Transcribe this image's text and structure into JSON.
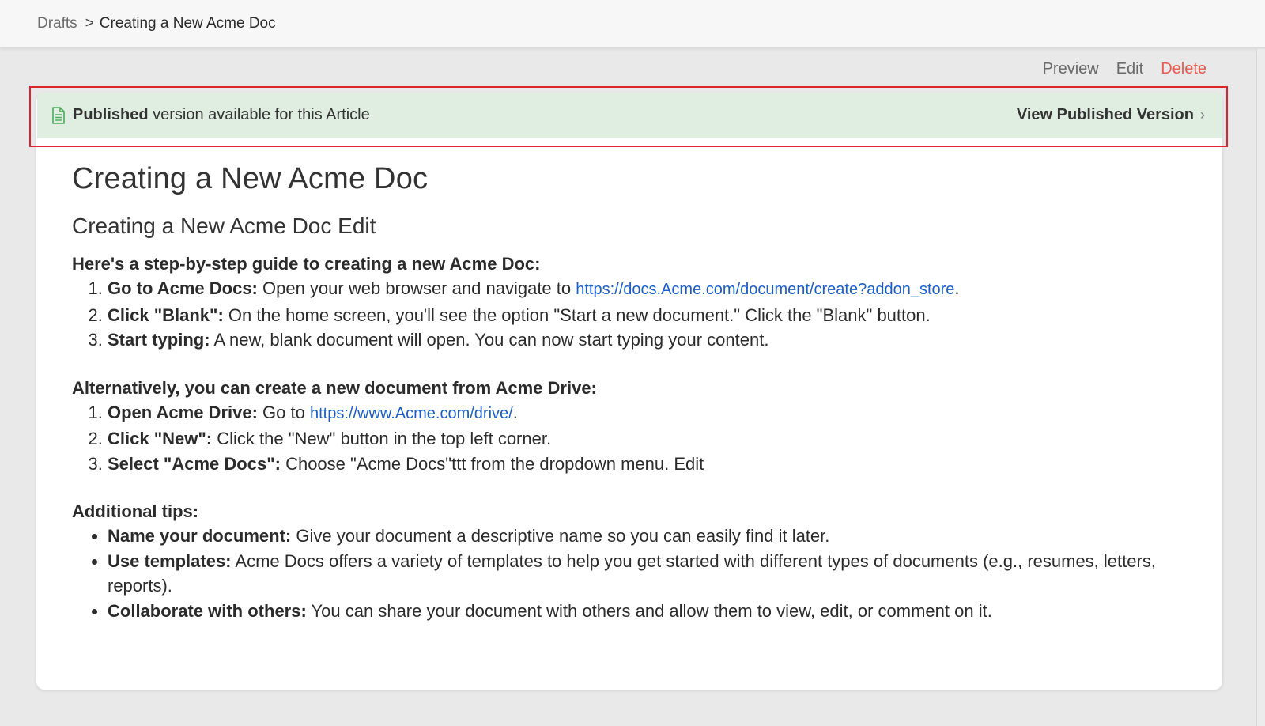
{
  "breadcrumb": {
    "parent": "Drafts",
    "separator": ">",
    "current": "Creating a New Acme Doc"
  },
  "actions": {
    "preview": "Preview",
    "edit": "Edit",
    "delete": "Delete"
  },
  "banner": {
    "icon": "document-icon",
    "bold_text": "Published",
    "text": "version available for this Article",
    "link_label": "View Published Version",
    "link_chevron": "›"
  },
  "doc": {
    "title": "Creating a New Acme Doc",
    "subtitle": "Creating a New Acme Doc Edit",
    "section1": {
      "heading": "Here's a step-by-step guide to creating a new Acme Doc:",
      "items": [
        {
          "label": "Go to Acme Docs:",
          "text": " Open your web browser and navigate to ",
          "link": "https://docs.Acme.com/document/create?addon_store",
          "after": "."
        },
        {
          "label": "Click \"Blank\":",
          "text": " On the home screen, you'll see the option \"Start a new document.\" Click the \"Blank\" button."
        },
        {
          "label": "Start typing:",
          "text": " A new, blank document will open. You can now start typing your content."
        }
      ]
    },
    "section2": {
      "heading": "Alternatively, you can create a new document from Acme Drive:",
      "items": [
        {
          "label": "Open Acme Drive:",
          "text": " Go to ",
          "link": "https://www.Acme.com/drive/",
          "after": "."
        },
        {
          "label": "Click \"New\":",
          "text": " Click the \"New\" button in the top left corner."
        },
        {
          "label": "Select \"Acme Docs\":",
          "text": " Choose \"Acme Docs\"ttt from the dropdown menu. Edit"
        }
      ]
    },
    "section3": {
      "heading": "Additional tips:",
      "items": [
        {
          "label": "Name your document:",
          "text": " Give your document a descriptive name so you can easily find it later."
        },
        {
          "label": "Use templates:",
          "text": " Acme Docs offers a variety of templates to help you get started with different types of documents (e.g., resumes, letters, reports)."
        },
        {
          "label": "Collaborate with others:",
          "text": " You can share your document with others and allow them to view, edit, or comment on it."
        }
      ]
    }
  },
  "colors": {
    "banner_bg": "#e0eee2",
    "highlight": "#e0242c",
    "delete": "#e8594f",
    "link": "#1a5fc9"
  }
}
